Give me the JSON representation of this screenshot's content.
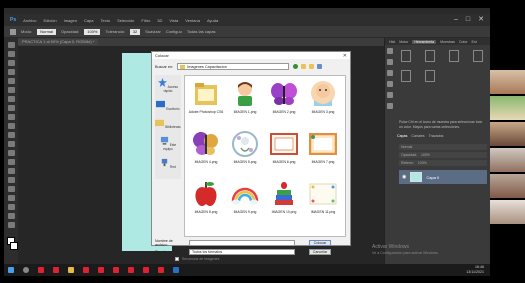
{
  "app": {
    "doc_tab": "PRACTICA 1 al 50% (Capa 0, RGB/8#) *",
    "menus": [
      "Archivo",
      "Edición",
      "Imagen",
      "Capa",
      "Texto",
      "Selección",
      "Filtro",
      "3D",
      "Vista",
      "Ventana",
      "Ayuda"
    ],
    "options": {
      "mode_label": "Modo:",
      "mode_value": "Normal",
      "opacity_label": "Opacidad:",
      "opacity_value": "100%",
      "tolerance_label": "Tolerancia:",
      "tolerance_value": "32",
      "antialias": "Suavizar",
      "contiguous": "Contiguo",
      "all_layers": "Todas las capas"
    },
    "window_controls": [
      "–",
      "□",
      "✕"
    ]
  },
  "right_panel": {
    "tabs": [
      "Hist",
      "Motor",
      "Herramienta",
      "Muestras",
      "Color",
      "Est"
    ],
    "hint": "Pulse Ctrl en el icono de muestra para seleccionar todo un color. Mayús para varias selecciones.",
    "layers_tabs": [
      "Capas",
      "Canales",
      "Trazados"
    ],
    "blend_mode": "Normal",
    "opacity_label": "Opacidad:",
    "opacity_value": "100%",
    "fill_label": "Relleno:",
    "fill_value": "100%",
    "layer_name": "Capa 0"
  },
  "dialog": {
    "title": "Colocar",
    "look_in_label": "Buscar en:",
    "look_in_value": "Imagenes Capacitacion",
    "places": [
      "Acceso rápido",
      "Escritorio",
      "Bibliotecas",
      "Este equipo",
      "Red"
    ],
    "files": [
      {
        "name": "Adobe Photoshop CS6",
        "kind": "folder"
      },
      {
        "name": "IMAGEN 1.png",
        "kind": "child"
      },
      {
        "name": "IMAGEN 2.png",
        "kind": "butterfly-purple"
      },
      {
        "name": "IMAGEN 3.png",
        "kind": "baby"
      },
      {
        "name": "IMAGEN 4.png",
        "kind": "butterfly"
      },
      {
        "name": "IMAGEN 5.png",
        "kind": "flowers"
      },
      {
        "name": "IMAGEN 6.png",
        "kind": "frame-red"
      },
      {
        "name": "IMAGEN 7.png",
        "kind": "frame-orange"
      },
      {
        "name": "IMAGEN 8.png",
        "kind": "apple"
      },
      {
        "name": "IMAGEN 9.png",
        "kind": "rainbow"
      },
      {
        "name": "IMAGEN 10.png",
        "kind": "books"
      },
      {
        "name": "IMAGEN 11.png",
        "kind": "frame-stars"
      }
    ],
    "filename_label": "Nombre de archivo:",
    "filetype_label": "Tipo de archivo:",
    "filetype_value": "Todos los formatos",
    "open_button": "Colocar",
    "cancel_button": "Cancelar",
    "sequence_label": "Secuencia de imágenes"
  },
  "activation": {
    "line1": "Activar Windows",
    "line2": "Ve a Configuración para activar Windows."
  },
  "clock": {
    "time": "16:46",
    "date": "13/11/2021"
  }
}
